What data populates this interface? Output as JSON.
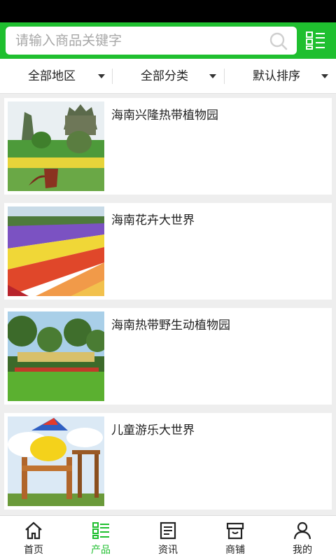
{
  "search": {
    "placeholder": "请输入商品关键字",
    "value": ""
  },
  "filters": [
    {
      "label": "全部地区"
    },
    {
      "label": "全部分类"
    },
    {
      "label": "默认排序"
    }
  ],
  "products": [
    {
      "title": "海南兴隆热带植物园"
    },
    {
      "title": "海南花卉大世界"
    },
    {
      "title": "海南热带野生动植物园"
    },
    {
      "title": "儿童游乐大世界"
    }
  ],
  "nav": [
    {
      "label": "首页",
      "icon": "home-icon"
    },
    {
      "label": "产品",
      "icon": "product-list-icon",
      "active": true
    },
    {
      "label": "资讯",
      "icon": "news-icon"
    },
    {
      "label": "商铺",
      "icon": "shop-icon"
    },
    {
      "label": "我的",
      "icon": "user-icon"
    }
  ],
  "colors": {
    "accent": "#1fbf2f",
    "background": "#eeeeee"
  }
}
